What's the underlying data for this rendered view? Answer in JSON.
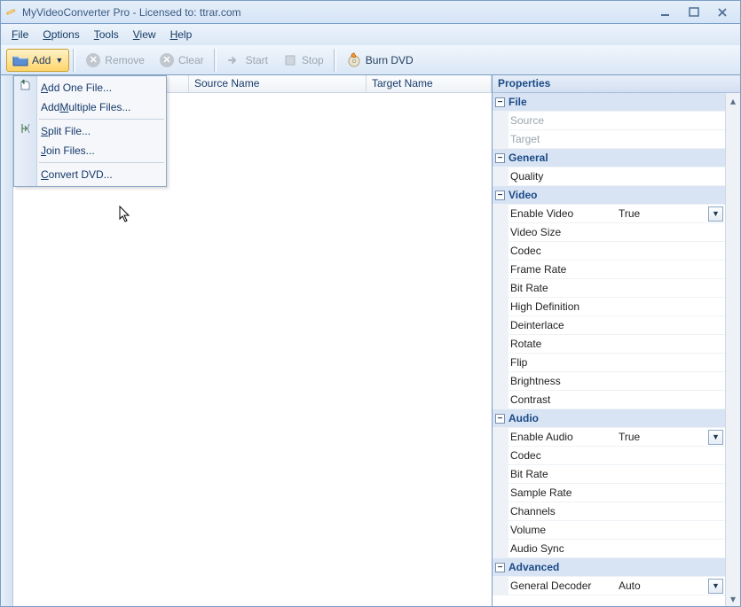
{
  "window": {
    "title": "MyVideoConverter Pro - Licensed to: ttrar.com"
  },
  "menu": {
    "file": "File",
    "options": "Options",
    "tools": "Tools",
    "view": "View",
    "help": "Help"
  },
  "toolbar": {
    "add": "Add",
    "remove": "Remove",
    "clear": "Clear",
    "start": "Start",
    "stop": "Stop",
    "burn": "Burn DVD"
  },
  "addmenu": {
    "addone": "dd One File...",
    "addmulti": "ultiple Files...",
    "split": "plit File...",
    "join": "oin Files...",
    "convert": "onvert DVD..."
  },
  "grid": {
    "col_source": "Source Name",
    "col_target": "Target Name"
  },
  "properties": {
    "title": "Properties",
    "cats": {
      "file": "File",
      "general": "General",
      "video": "Video",
      "audio": "Audio",
      "advanced": "Advanced"
    },
    "rows": {
      "source": "Source",
      "target": "Target",
      "quality": "Quality",
      "enable_video": "Enable Video",
      "enable_video_val": "True",
      "video_size": "Video Size",
      "codec_v": "Codec",
      "frame_rate": "Frame Rate",
      "bitrate_v": "Bit Rate",
      "high_def": "High Definition",
      "deinterlace": "Deinterlace",
      "rotate": "Rotate",
      "flip": "Flip",
      "brightness": "Brightness",
      "contrast": "Contrast",
      "enable_audio": "Enable Audio",
      "enable_audio_val": "True",
      "codec_a": "Codec",
      "bitrate_a": "Bit Rate",
      "sample_rate": "Sample Rate",
      "channels": "Channels",
      "volume": "Volume",
      "audio_sync": "Audio Sync",
      "gen_decoder": "General Decoder",
      "gen_decoder_val": "Auto"
    }
  }
}
